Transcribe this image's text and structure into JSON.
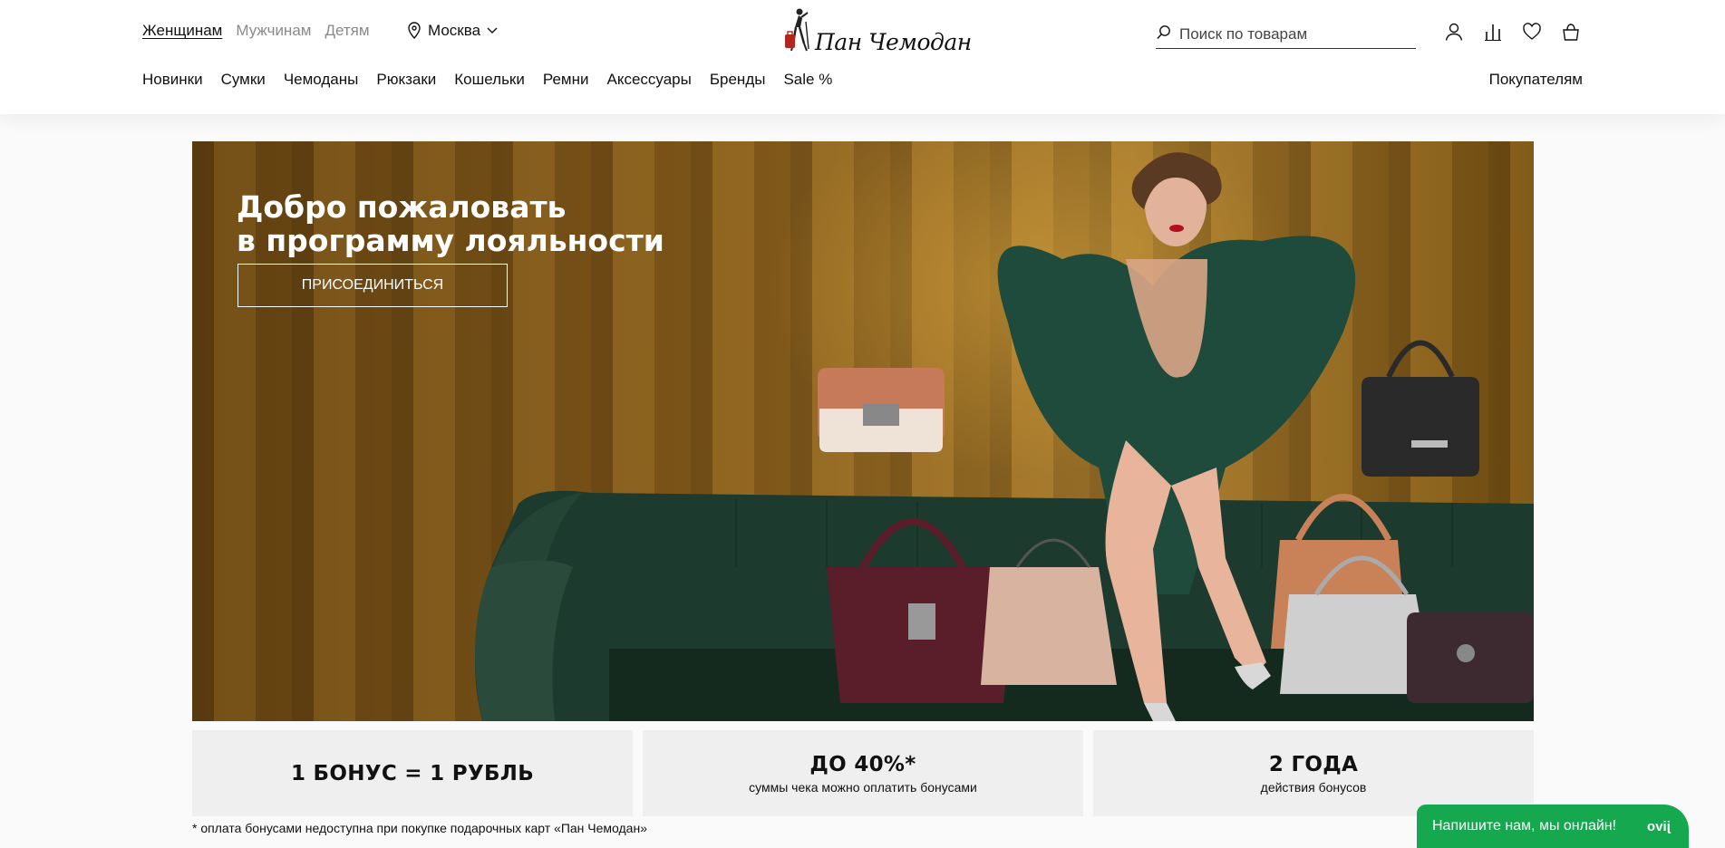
{
  "header": {
    "gender_tabs": [
      {
        "label": "Женщинам",
        "active": true
      },
      {
        "label": "Мужчинам",
        "active": false
      },
      {
        "label": "Детям",
        "active": false
      }
    ],
    "city": "Москва",
    "logo_text": "Пан Чемодан",
    "search_placeholder": "Поиск по товарам",
    "icons": [
      "user-icon",
      "compare-icon",
      "heart-icon",
      "bag-icon"
    ],
    "categories": [
      "Новинки",
      "Сумки",
      "Чемоданы",
      "Рюкзаки",
      "Кошельки",
      "Ремни",
      "Аксессуары",
      "Бренды",
      "Sale %"
    ],
    "buyers_link": "Покупателям"
  },
  "hero": {
    "title_line1": "Добро пожаловать",
    "title_line2": "в программу лояльности",
    "button_label": "ПРИСОЕДИНИТЬСЯ"
  },
  "benefits": [
    {
      "big": "1 БОНУС = 1 РУБЛЬ",
      "small": ""
    },
    {
      "big": "ДО 40%*",
      "small": "суммы чека можно оплатить бонусами"
    },
    {
      "big": "2 ГОДА",
      "small": "действия бонусов"
    }
  ],
  "footnote": "* оплата бонусами недоступна при покупке подарочных карт «Пан Чемодан»",
  "chat": {
    "label": "Напишите нам, мы онлайн!",
    "brand": "jivo",
    "color": "#15a84e"
  },
  "colors": {
    "accent": "#111111",
    "card_bg": "#efefef",
    "sofa": "#1f3a2e",
    "dress": "#1f4a3b"
  }
}
